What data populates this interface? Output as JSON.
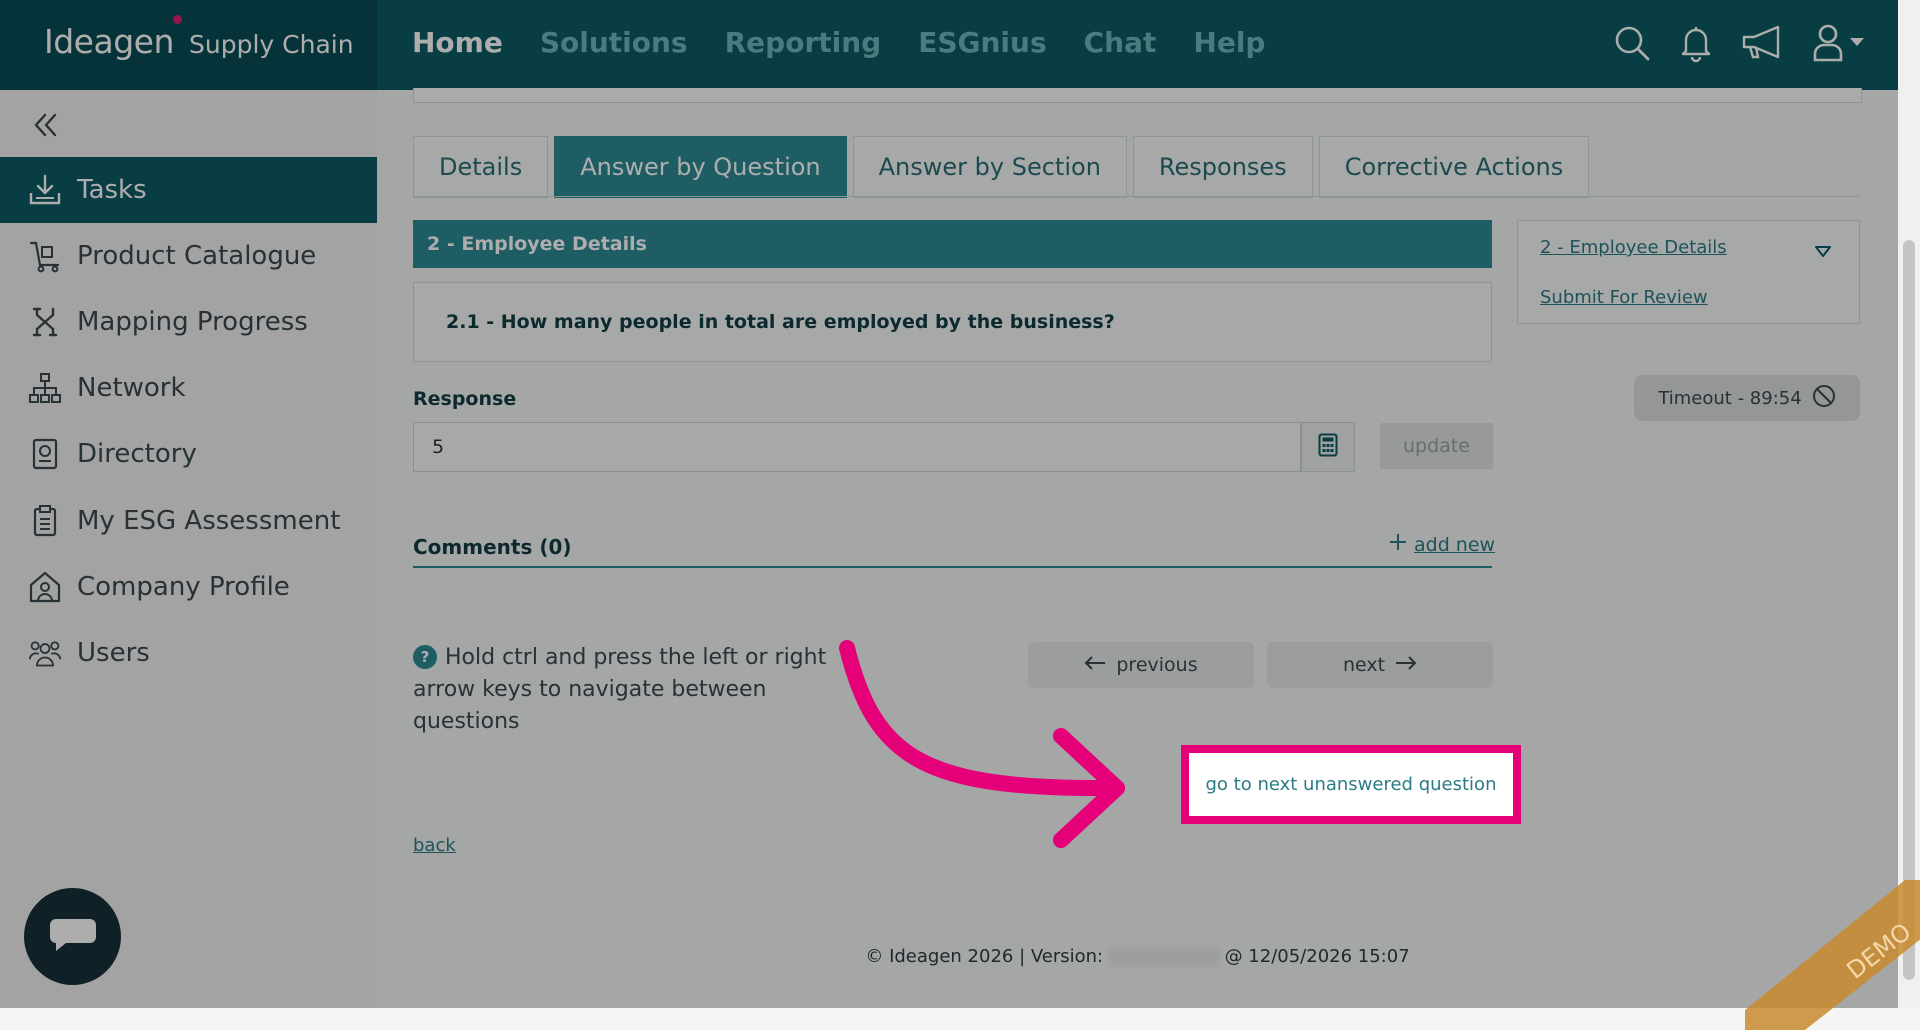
{
  "brand": {
    "logo_text": "Ideagen",
    "logo_sub": "Supply Chain"
  },
  "nav": {
    "items": [
      {
        "label": "Home",
        "active": true
      },
      {
        "label": "Solutions"
      },
      {
        "label": "Reporting"
      },
      {
        "label": "ESGnius"
      },
      {
        "label": "Chat"
      },
      {
        "label": "Help"
      }
    ]
  },
  "sidebar": {
    "items": [
      {
        "label": "Tasks",
        "icon": "download-tray-icon",
        "active": true
      },
      {
        "label": "Product Catalogue",
        "icon": "trolley-icon"
      },
      {
        "label": "Mapping Progress",
        "icon": "route-icon"
      },
      {
        "label": "Network",
        "icon": "network-icon"
      },
      {
        "label": "Directory",
        "icon": "directory-icon"
      },
      {
        "label": "My ESG Assessment",
        "icon": "clipboard-icon"
      },
      {
        "label": "Company Profile",
        "icon": "building-icon"
      },
      {
        "label": "Users",
        "icon": "users-icon"
      }
    ]
  },
  "tabs": [
    {
      "label": "Details"
    },
    {
      "label": "Answer by Question",
      "active": true
    },
    {
      "label": "Answer by Section"
    },
    {
      "label": "Responses"
    },
    {
      "label": "Corrective Actions"
    }
  ],
  "section": {
    "title": "2 - Employee Details"
  },
  "question": {
    "text": "2.1 - How many people in total are employed by the business?"
  },
  "response": {
    "label": "Response",
    "value": "5",
    "update_label": "update"
  },
  "comments": {
    "label": "Comments (0)",
    "add_new_label": "add new"
  },
  "help": {
    "text": "Hold ctrl and press the left or right arrow keys to navigate between questions"
  },
  "navigation": {
    "previous_label": "previous",
    "next_label": "next",
    "next_unanswered_label": "go to next unanswered question",
    "back_label": "back"
  },
  "right_panel": {
    "section_link": "2 - Employee Details",
    "submit_link": "Submit For Review",
    "timeout_label": "Timeout - 89:54"
  },
  "footer": {
    "prefix": "© Ideagen 2026 | Version:",
    "suffix": "@ 12/05/2026 15:07"
  },
  "demo_badge": "DEMO",
  "colors": {
    "primary": "#0b5a63",
    "accent": "#2b8a93",
    "highlight": "#e5007a"
  }
}
